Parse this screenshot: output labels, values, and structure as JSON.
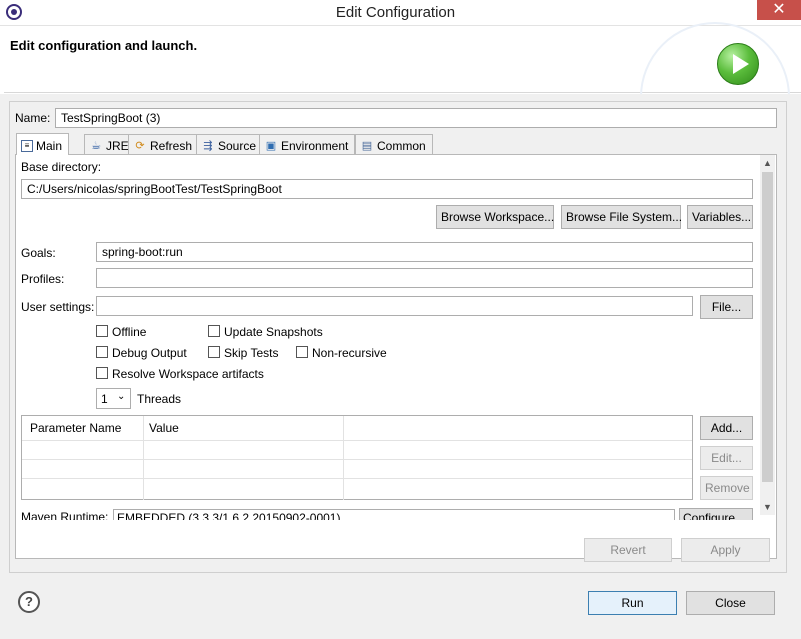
{
  "window": {
    "title": "Edit Configuration",
    "close_symbol": "✕"
  },
  "header": {
    "text": "Edit configuration and launch."
  },
  "name": {
    "label": "Name:",
    "value": "TestSpringBoot (3)"
  },
  "tabs": [
    {
      "label": "Main",
      "icon": "main-tab-icon",
      "active": true
    },
    {
      "label": "JRE",
      "icon": "jre-icon"
    },
    {
      "label": "Refresh",
      "icon": "refresh-icon"
    },
    {
      "label": "Source",
      "icon": "source-icon"
    },
    {
      "label": "Environment",
      "icon": "environment-icon"
    },
    {
      "label": "Common",
      "icon": "common-icon"
    }
  ],
  "main": {
    "base_dir_label": "Base directory:",
    "base_dir_value": "C:/Users/nicolas/springBootTest/TestSpringBoot",
    "browse_workspace": "Browse Workspace...",
    "browse_fs": "Browse File System...",
    "variables": "Variables...",
    "goals_label": "Goals:",
    "goals_value": "spring-boot:run",
    "profiles_label": "Profiles:",
    "profiles_value": "",
    "user_settings_label": "User settings:",
    "user_settings_value": "",
    "file_button": "File...",
    "checks": {
      "offline": "Offline",
      "update_snapshots": "Update Snapshots",
      "debug_output": "Debug Output",
      "skip_tests": "Skip Tests",
      "non_recursive": "Non-recursive",
      "resolve_workspace": "Resolve Workspace artifacts"
    },
    "threads_value": "1",
    "threads_label": "Threads",
    "table": {
      "headers": [
        "Parameter Name",
        "Value"
      ]
    },
    "add": "Add...",
    "edit": "Edit...",
    "remove": "Remove",
    "runtime_label": "Maven Runtime:",
    "runtime_value": "EMBEDDED (3.3.3/1.6.2.20150902-0001)",
    "configure": "Configure..."
  },
  "footer": {
    "revert": "Revert",
    "apply": "Apply",
    "run": "Run",
    "close": "Close",
    "help_symbol": "?"
  }
}
